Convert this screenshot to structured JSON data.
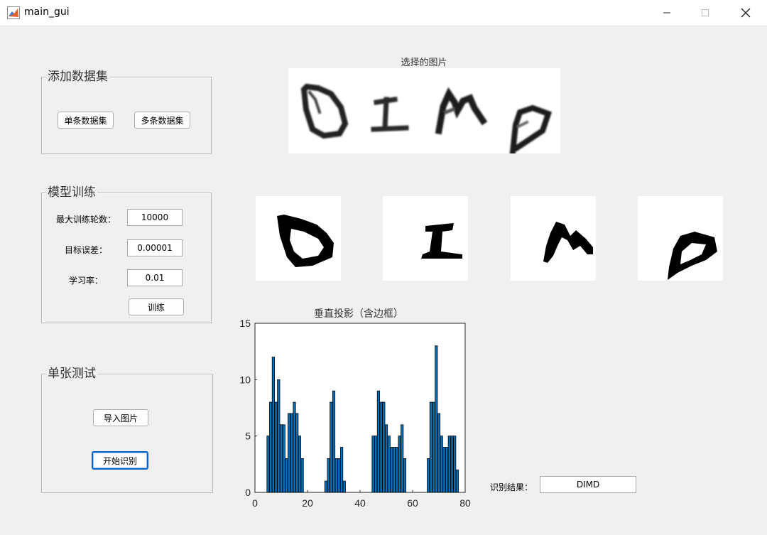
{
  "window": {
    "title": "main_gui",
    "minimize_icon": "minimize-icon",
    "maximize_icon": "maximize-icon",
    "close_icon": "close-icon"
  },
  "dataset_panel": {
    "title": "添加数据集",
    "single_label": "单条数据集",
    "multi_label": "多条数据集"
  },
  "train_panel": {
    "title": "模型训练",
    "epochs_label": "最大训练轮数：",
    "epochs_value": "10000",
    "goal_label": "目标误差：",
    "goal_value": "0.00001",
    "lr_label": "学习率：",
    "lr_value": "0.01",
    "train_label": "训练"
  },
  "test_panel": {
    "title": "单张测试",
    "import_label": "导入图片",
    "recognize_label": "开始识别"
  },
  "selected_image": {
    "title": "选择的图片",
    "characters": [
      "D",
      "I",
      "M",
      "D"
    ]
  },
  "segments": [
    "D",
    "I",
    "M",
    "D"
  ],
  "result": {
    "label": "识别结果：",
    "value": "DIMD"
  },
  "chart_data": {
    "type": "bar",
    "title": "垂直投影（含边框）",
    "xlabel": "",
    "ylabel": "",
    "xlim": [
      0,
      80
    ],
    "ylim": [
      0,
      15
    ],
    "xticks": [
      0,
      20,
      40,
      60,
      80
    ],
    "yticks": [
      0,
      5,
      10,
      15
    ],
    "bar_color": "#0072bd",
    "x": [
      5,
      6,
      7,
      8,
      9,
      10,
      11,
      12,
      13,
      14,
      15,
      16,
      17,
      18,
      27,
      28,
      29,
      30,
      31,
      32,
      33,
      34,
      45,
      46,
      47,
      48,
      49,
      50,
      51,
      52,
      53,
      54,
      55,
      56,
      57,
      58,
      66,
      67,
      68,
      69,
      70,
      71,
      72,
      73,
      74,
      75,
      76,
      77
    ],
    "values": [
      5,
      8,
      12,
      8,
      10,
      6,
      6,
      3,
      7,
      7,
      8,
      7,
      5,
      3,
      1,
      3,
      8,
      9,
      3,
      3,
      4,
      1,
      5,
      5,
      9,
      8,
      8,
      6,
      5,
      4,
      4,
      4,
      5,
      6,
      3,
      0,
      3,
      8,
      8,
      13,
      7,
      5,
      4,
      4,
      5,
      5,
      5,
      2
    ]
  }
}
